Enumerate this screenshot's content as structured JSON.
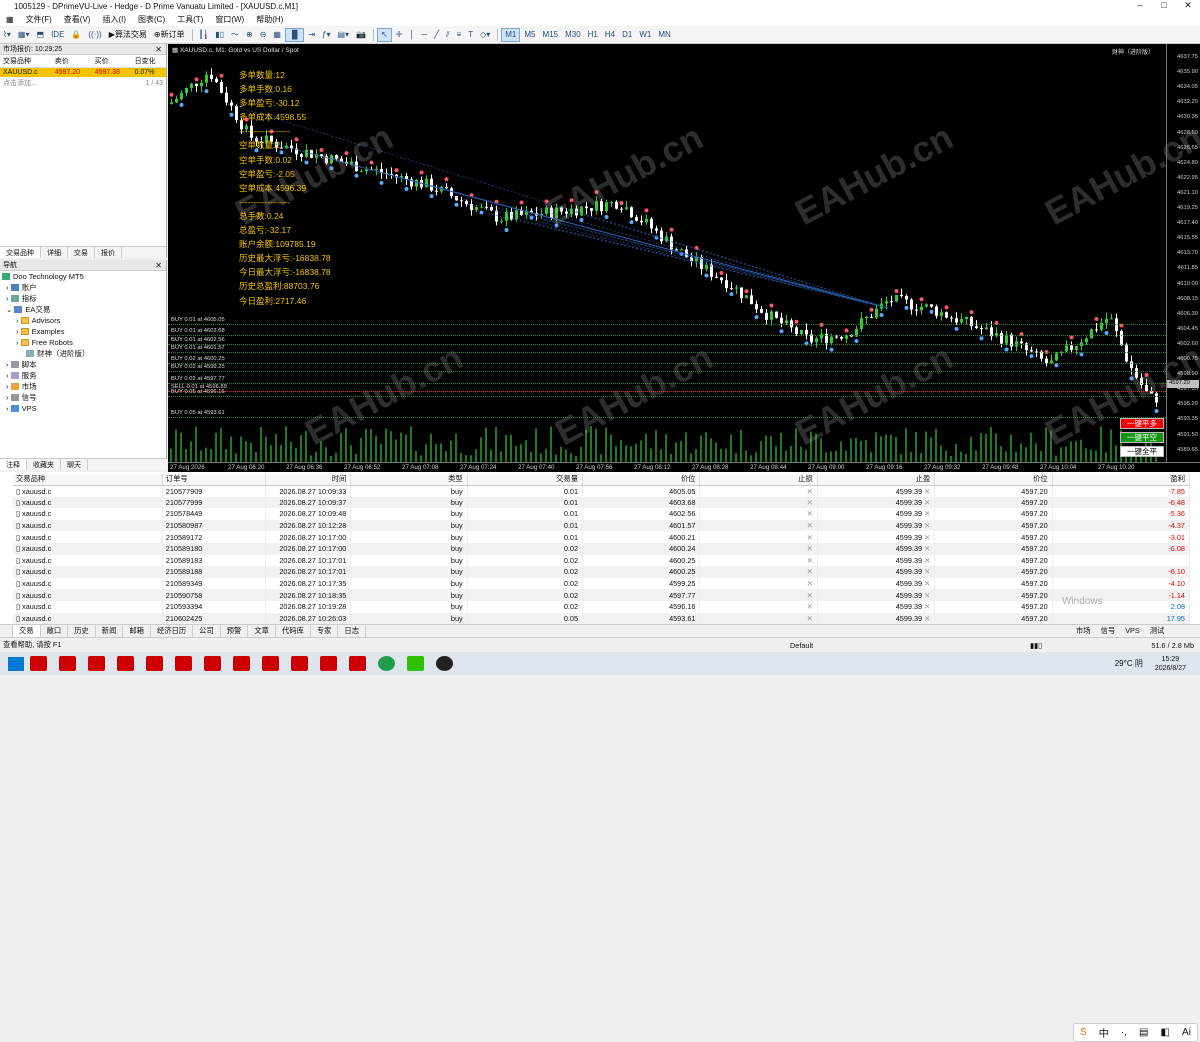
{
  "window": {
    "title": "1005129 - DPrimeVU-Live - Hedge - D Prime Vanuatu Limited - [XAUUSD.c,M1]"
  },
  "menu": [
    "文件(F)",
    "查看(V)",
    "插入(I)",
    "图表(C)",
    "工具(T)",
    "窗口(W)",
    "帮助(H)"
  ],
  "toolbar": {
    "ide": "IDE",
    "algo": "算法交易",
    "new_order": "新订单",
    "timeframes": [
      "M1",
      "M5",
      "M15",
      "M30",
      "H1",
      "H4",
      "D1",
      "W1",
      "MN"
    ],
    "active_tf": "M1"
  },
  "market_watch": {
    "title": "市场报价: 10:29:25",
    "headers": [
      "交易品种",
      "卖价",
      "买价",
      "日变化"
    ],
    "symbol": "XAUUSD.c",
    "bid": "4597.20",
    "ask": "4597.38",
    "change": "0.07%",
    "add": "点击添加...",
    "count": "1 / 43",
    "tabs": [
      "交易品种",
      "详细",
      "交易",
      "报价"
    ]
  },
  "navigator": {
    "title": "导航",
    "items": [
      "Doo Technology MT5",
      "账户",
      "指标",
      "EA交易",
      "Advisors",
      "Examples",
      "Free Robots",
      "财神（进阶版）",
      "脚本",
      "服务",
      "市场",
      "信号",
      "VPS"
    ],
    "tabs": [
      "注释",
      "收藏夹",
      "聊天"
    ]
  },
  "chart": {
    "title": "XAUUSD.c, M1: Gold vs US Dollar / Spot",
    "ea_name": "财神（进阶版）",
    "info": [
      "多单数量:12",
      "多单手数:0.16",
      "多单盈亏:-30.12",
      "多单成本:4598.55",
      "------------------",
      "空单数量:2",
      "空单手数:0.02",
      "空单盈亏:-2.05",
      "空单成本:4596.39",
      "------------------",
      "总手数:0.24",
      "总盈亏:-32.17",
      "账户余额:109785.19",
      "历史最大浮亏:-16838.78",
      "今日最大浮亏:-16838.78",
      "历史总盈利:88703.76",
      "今日盈利:2717.46"
    ],
    "price_labels": [
      "4637.75",
      "4635.90",
      "4634.05",
      "4632.20",
      "4630.35",
      "4628.50",
      "4626.65",
      "4624.80",
      "4622.95",
      "4621.10",
      "4619.25",
      "4617.40",
      "4615.55",
      "4613.70",
      "4611.85",
      "4610.00",
      "4608.15",
      "4606.30",
      "4604.45",
      "4602.60",
      "4600.75",
      "4598.90",
      "4597.05",
      "4595.20",
      "4593.35",
      "4591.50",
      "4589.65"
    ],
    "current_price": "4597.20",
    "time_labels": [
      "27 Aug 2026",
      "27 Aug 06:20",
      "27 Aug 06:36",
      "27 Aug 06:52",
      "27 Aug 07:08",
      "27 Aug 07:24",
      "27 Aug 07:40",
      "27 Aug 07:56",
      "27 Aug 08:12",
      "27 Aug 08:28",
      "27 Aug 08:44",
      "27 Aug 09:00",
      "27 Aug 09:16",
      "27 Aug 09:32",
      "27 Aug 09:48",
      "27 Aug 10:04",
      "27 Aug 10:20"
    ],
    "order_lines": [
      "BUY 0.01 at 4605.05",
      "BUY 0.01 at 4603.68",
      "BUY 0.01 at 4602.56",
      "BUY 0.01 at 4601.57",
      "BUY 0.02 at 4600.25",
      "BUY 0.02 at 4599.25",
      "BUY 0.02 at 4597.77",
      "SELL 0.01 at 4596.89",
      "BUY 0.05 at 4596.16",
      "BUY 0.05 at 4593.61"
    ],
    "buttons": {
      "sell_close": "一键平多",
      "buy_close": "一键平空",
      "close_all": "一键全平"
    },
    "watermark": "EAHub.cn"
  },
  "positions": {
    "headers": [
      "交易品种",
      "订单号",
      "时间",
      "类型",
      "交易量",
      "价位",
      "止损",
      "止盈",
      "价位",
      "盈利"
    ],
    "rows": [
      [
        "xauusd.c",
        "210577909",
        "2026.08.27 10:09:33",
        "buy",
        "0.01",
        "4605.05",
        "",
        "4599.39",
        "4597.20",
        "-7.85"
      ],
      [
        "xauusd.c",
        "210577999",
        "2026.08.27 10:09:37",
        "buy",
        "0.01",
        "4603.68",
        "",
        "4599.39",
        "4597.20",
        "-6.48"
      ],
      [
        "xauusd.c",
        "210578449",
        "2026.08.27 10:09:48",
        "buy",
        "0.01",
        "4602.56",
        "",
        "4599.39",
        "4597.20",
        "-5.36"
      ],
      [
        "xauusd.c",
        "210580987",
        "2026.08.27 10:12:28",
        "buy",
        "0.01",
        "4601.57",
        "",
        "4599.39",
        "4597.20",
        "-4.37"
      ],
      [
        "xauusd.c",
        "210589172",
        "2026.08.27 10:17:00",
        "buy",
        "0.01",
        "4600.21",
        "",
        "4599.39",
        "4597.20",
        "-3.01"
      ],
      [
        "xauusd.c",
        "210589180",
        "2026.08.27 10:17:00",
        "buy",
        "0.02",
        "4600.24",
        "",
        "4599.39",
        "4597.20",
        "-6.08"
      ],
      [
        "xauusd.c",
        "210589183",
        "2026.08.27 10:17:01",
        "buy",
        "0.02",
        "4600.25",
        "",
        "4599.39",
        "4597.20",
        ""
      ],
      [
        "xauusd.c",
        "210589188",
        "2026.08.27 10:17:01",
        "buy",
        "0.02",
        "4600.25",
        "",
        "4599.39",
        "4597.20",
        "-6.10"
      ],
      [
        "xauusd.c",
        "210589349",
        "2026.08.27 10:17:35",
        "buy",
        "0.02",
        "4599.25",
        "",
        "4599.39",
        "4597.20",
        "-4.10"
      ],
      [
        "xauusd.c",
        "210590758",
        "2026.08.27 10:18:35",
        "buy",
        "0.02",
        "4597.77",
        "",
        "4599.39",
        "4597.20",
        "-1.14"
      ],
      [
        "xauusd.c",
        "210593394",
        "2026.08.27 10:19:28",
        "buy",
        "0.02",
        "4596.16",
        "",
        "4599.39",
        "4597.20",
        "2.08"
      ],
      [
        "xauusd.c",
        "210602425",
        "2026.08.27 10:26:03",
        "buy",
        "0.05",
        "4593.61",
        "",
        "4599.39",
        "4597.20",
        "17.95"
      ]
    ]
  },
  "terminal_tabs": [
    "交易",
    "敞口",
    "历史",
    "新闻",
    "邮箱",
    "经济日历",
    "公司",
    "预警",
    "文章",
    "代码库",
    "专家",
    "日志"
  ],
  "status": {
    "help": "查看帮助, 请按 F1",
    "profile": "Default",
    "market": "市场",
    "signals": "信号",
    "vps": "VPS",
    "test": "测试",
    "traffic": "51.6 / 2.8 Mb",
    "sys_text": "Windows",
    "weather": "29°C 阴",
    "clock_time": "15:29",
    "clock_date": "2026/8/27"
  }
}
